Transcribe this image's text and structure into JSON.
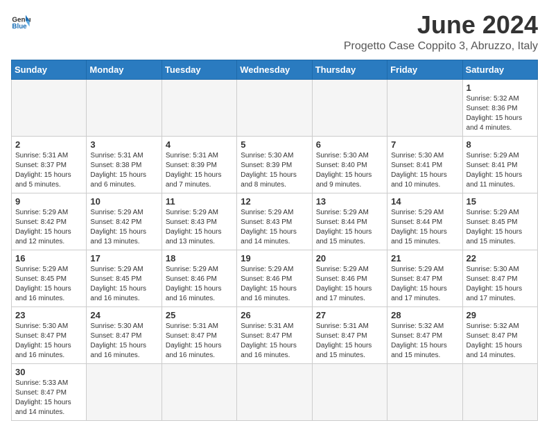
{
  "header": {
    "logo_general": "General",
    "logo_blue": "Blue",
    "title": "June 2024",
    "subtitle": "Progetto Case Coppito 3, Abruzzo, Italy"
  },
  "weekdays": [
    "Sunday",
    "Monday",
    "Tuesday",
    "Wednesday",
    "Thursday",
    "Friday",
    "Saturday"
  ],
  "weeks": [
    [
      {
        "day": null
      },
      {
        "day": null
      },
      {
        "day": null
      },
      {
        "day": null
      },
      {
        "day": null
      },
      {
        "day": null
      },
      {
        "day": "1",
        "sunrise": "5:32 AM",
        "sunset": "8:36 PM",
        "daylight": "15 hours and 4 minutes."
      }
    ],
    [
      {
        "day": "2",
        "sunrise": "5:31 AM",
        "sunset": "8:37 PM",
        "daylight": "15 hours and 5 minutes."
      },
      {
        "day": "3",
        "sunrise": "5:31 AM",
        "sunset": "8:38 PM",
        "daylight": "15 hours and 6 minutes."
      },
      {
        "day": "4",
        "sunrise": "5:31 AM",
        "sunset": "8:39 PM",
        "daylight": "15 hours and 7 minutes."
      },
      {
        "day": "5",
        "sunrise": "5:30 AM",
        "sunset": "8:39 PM",
        "daylight": "15 hours and 8 minutes."
      },
      {
        "day": "6",
        "sunrise": "5:30 AM",
        "sunset": "8:40 PM",
        "daylight": "15 hours and 9 minutes."
      },
      {
        "day": "7",
        "sunrise": "5:30 AM",
        "sunset": "8:41 PM",
        "daylight": "15 hours and 10 minutes."
      },
      {
        "day": "8",
        "sunrise": "5:29 AM",
        "sunset": "8:41 PM",
        "daylight": "15 hours and 11 minutes."
      }
    ],
    [
      {
        "day": "9",
        "sunrise": "5:29 AM",
        "sunset": "8:42 PM",
        "daylight": "15 hours and 12 minutes."
      },
      {
        "day": "10",
        "sunrise": "5:29 AM",
        "sunset": "8:42 PM",
        "daylight": "15 hours and 13 minutes."
      },
      {
        "day": "11",
        "sunrise": "5:29 AM",
        "sunset": "8:43 PM",
        "daylight": "15 hours and 13 minutes."
      },
      {
        "day": "12",
        "sunrise": "5:29 AM",
        "sunset": "8:43 PM",
        "daylight": "15 hours and 14 minutes."
      },
      {
        "day": "13",
        "sunrise": "5:29 AM",
        "sunset": "8:44 PM",
        "daylight": "15 hours and 15 minutes."
      },
      {
        "day": "14",
        "sunrise": "5:29 AM",
        "sunset": "8:44 PM",
        "daylight": "15 hours and 15 minutes."
      },
      {
        "day": "15",
        "sunrise": "5:29 AM",
        "sunset": "8:45 PM",
        "daylight": "15 hours and 15 minutes."
      }
    ],
    [
      {
        "day": "16",
        "sunrise": "5:29 AM",
        "sunset": "8:45 PM",
        "daylight": "15 hours and 16 minutes."
      },
      {
        "day": "17",
        "sunrise": "5:29 AM",
        "sunset": "8:45 PM",
        "daylight": "15 hours and 16 minutes."
      },
      {
        "day": "18",
        "sunrise": "5:29 AM",
        "sunset": "8:46 PM",
        "daylight": "15 hours and 16 minutes."
      },
      {
        "day": "19",
        "sunrise": "5:29 AM",
        "sunset": "8:46 PM",
        "daylight": "15 hours and 16 minutes."
      },
      {
        "day": "20",
        "sunrise": "5:29 AM",
        "sunset": "8:46 PM",
        "daylight": "15 hours and 17 minutes."
      },
      {
        "day": "21",
        "sunrise": "5:29 AM",
        "sunset": "8:47 PM",
        "daylight": "15 hours and 17 minutes."
      },
      {
        "day": "22",
        "sunrise": "5:30 AM",
        "sunset": "8:47 PM",
        "daylight": "15 hours and 17 minutes."
      }
    ],
    [
      {
        "day": "23",
        "sunrise": "5:30 AM",
        "sunset": "8:47 PM",
        "daylight": "15 hours and 16 minutes."
      },
      {
        "day": "24",
        "sunrise": "5:30 AM",
        "sunset": "8:47 PM",
        "daylight": "15 hours and 16 minutes."
      },
      {
        "day": "25",
        "sunrise": "5:31 AM",
        "sunset": "8:47 PM",
        "daylight": "15 hours and 16 minutes."
      },
      {
        "day": "26",
        "sunrise": "5:31 AM",
        "sunset": "8:47 PM",
        "daylight": "15 hours and 16 minutes."
      },
      {
        "day": "27",
        "sunrise": "5:31 AM",
        "sunset": "8:47 PM",
        "daylight": "15 hours and 15 minutes."
      },
      {
        "day": "28",
        "sunrise": "5:32 AM",
        "sunset": "8:47 PM",
        "daylight": "15 hours and 15 minutes."
      },
      {
        "day": "29",
        "sunrise": "5:32 AM",
        "sunset": "8:47 PM",
        "daylight": "15 hours and 14 minutes."
      }
    ],
    [
      {
        "day": "30",
        "sunrise": "5:33 AM",
        "sunset": "8:47 PM",
        "daylight": "15 hours and 14 minutes."
      },
      {
        "day": null
      },
      {
        "day": null
      },
      {
        "day": null
      },
      {
        "day": null
      },
      {
        "day": null
      },
      {
        "day": null
      }
    ]
  ]
}
